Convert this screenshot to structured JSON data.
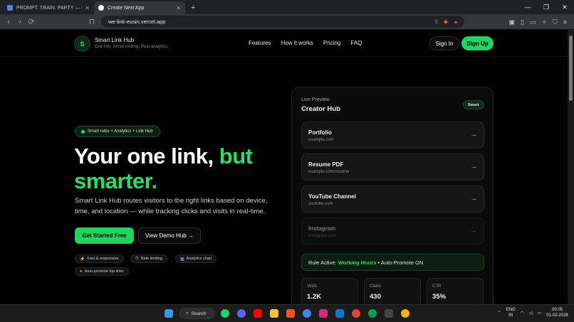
{
  "browser": {
    "tabs": [
      {
        "title": "PROMPT. TRAIN. PARTY — Hack Day",
        "active": false,
        "favicon_color": "#5b7cfa"
      },
      {
        "title": "Create Next App",
        "active": true,
        "favicon_color": "#ffffff"
      }
    ],
    "url": "we-link-eosin.vercel.app"
  },
  "site": {
    "logo_letter": "S",
    "brand_name": "Smart Link Hub",
    "brand_tagline": "One link. Smart routing. Real analytics.",
    "nav": [
      "Features",
      "How it works",
      "Pricing",
      "FAQ"
    ],
    "signin_label": "Sign In",
    "signup_label": "Sign Up"
  },
  "hero": {
    "pill_text": "Smart rules + Analytics + Link Hub",
    "headline_white": "Your one link,",
    "headline_green_1": "but",
    "headline_green_2": "smarter.",
    "description": "Smart Link Hub routes visitors to the right links based on device, time, and location — while tracking clicks and visits in real-time.",
    "cta_primary": "Get Started Free",
    "cta_secondary": "View Demo Hub →",
    "chips": [
      {
        "icon": "⚡",
        "label": "Fast & responsive"
      },
      {
        "icon": "⏱",
        "label": "Rate limiting"
      },
      {
        "icon": "▦",
        "label": "Analytics chart"
      },
      {
        "icon": "●",
        "label": "Auto-promote top links"
      }
    ]
  },
  "preview": {
    "eyebrow": "Live Preview",
    "title": "Creator Hub",
    "badge": "Smart",
    "links": [
      {
        "title": "Portfolio",
        "url": "example.com",
        "dim": false
      },
      {
        "title": "Resume PDF",
        "url": "example.com/resume",
        "dim": false
      },
      {
        "title": "YouTube Channel",
        "url": "youtube.com",
        "dim": false
      },
      {
        "title": "Instagram",
        "url": "instagram.com",
        "dim": true
      }
    ],
    "rule_prefix": "Rule Active: ",
    "rule_highlight": "Working Hours",
    "rule_suffix": " • Auto-Promote ON",
    "stats": [
      {
        "label": "Visits",
        "value": "1.2K"
      },
      {
        "label": "Clicks",
        "value": "430"
      },
      {
        "label": "CTR",
        "value": "35%"
      }
    ]
  },
  "taskbar": {
    "search_label": "Search",
    "lang_top": "ENG",
    "lang_bottom": "IN",
    "time": "00:05",
    "date": "01-02-2026"
  }
}
